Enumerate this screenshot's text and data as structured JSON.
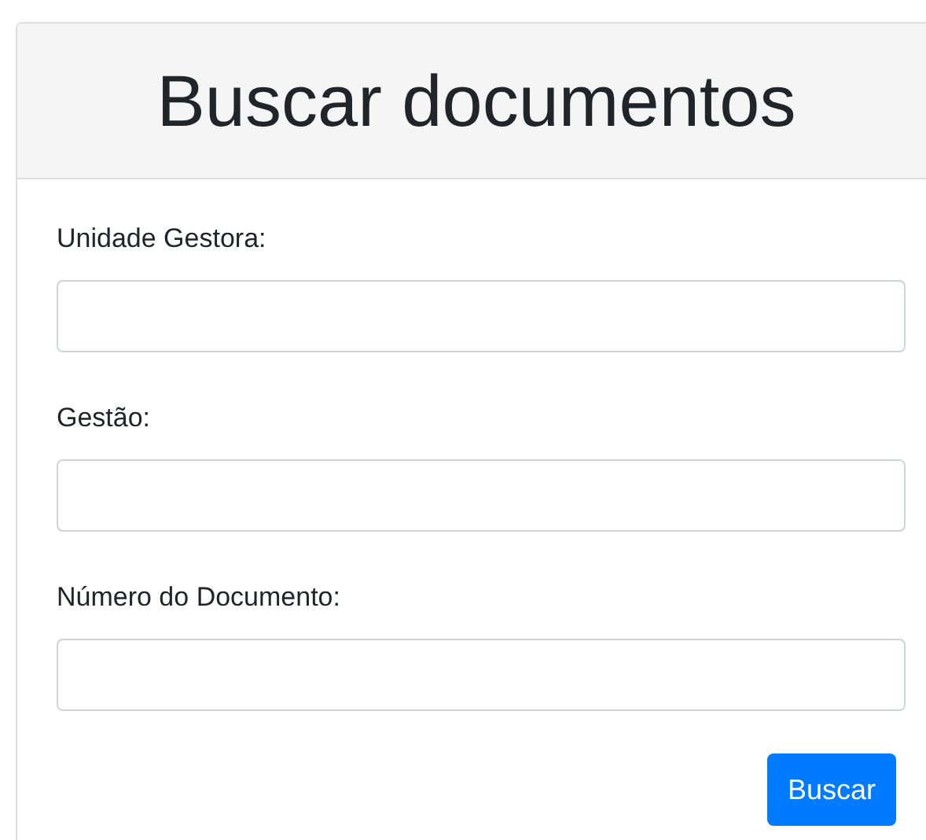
{
  "header": {
    "title": "Buscar documentos"
  },
  "fields": [
    {
      "label": "Unidade Gestora:"
    },
    {
      "label": "Gestão:"
    },
    {
      "label": "Número do Documento:"
    }
  ],
  "button": {
    "label": "Buscar"
  }
}
